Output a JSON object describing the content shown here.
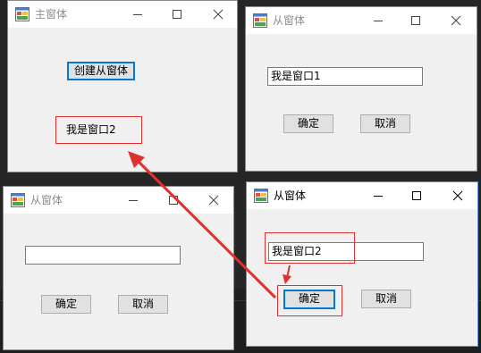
{
  "main_window": {
    "title": "主窗体",
    "create_button": "创建从窗体",
    "label": "我是窗口2"
  },
  "child_window_1": {
    "title": "从窗体",
    "textbox_value": "我是窗口1",
    "ok_button": "确定",
    "cancel_button": "取消"
  },
  "child_window_2": {
    "title": "从窗体",
    "textbox_value": "",
    "ok_button": "确定",
    "cancel_button": "取消"
  },
  "child_window_3": {
    "title": "从窗体",
    "textbox_value": "我是窗口2",
    "ok_button": "确定",
    "cancel_button": "取消"
  },
  "colors": {
    "annotation": "#e03131",
    "focus": "#0078d7",
    "background": "#262626"
  },
  "icons": [
    "app-icon",
    "minimize-icon",
    "maximize-icon",
    "close-icon"
  ]
}
